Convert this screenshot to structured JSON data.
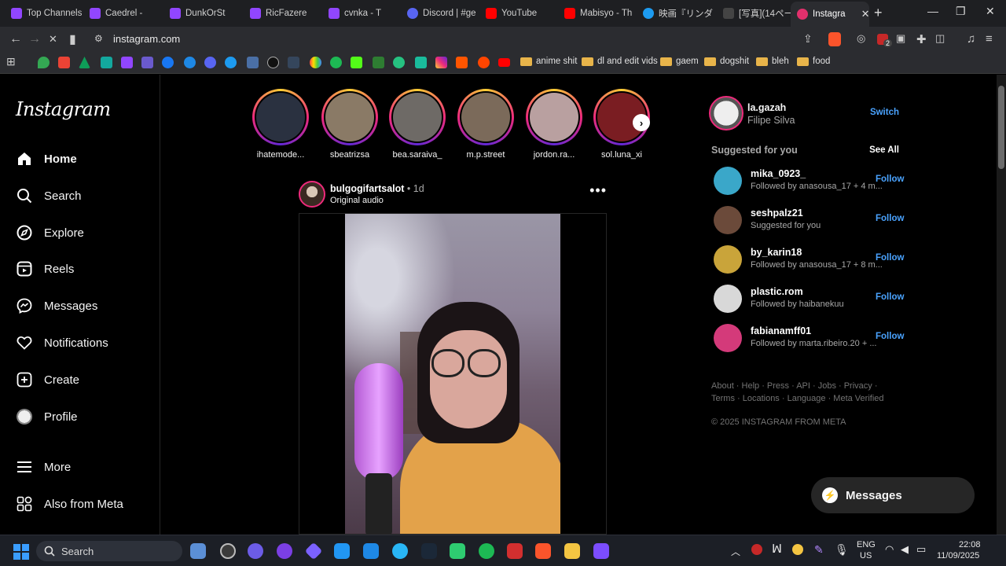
{
  "browser": {
    "tabs": [
      {
        "label": "Top Channels",
        "color": "#9146ff"
      },
      {
        "label": "Caedrel -",
        "color": "#9146ff"
      },
      {
        "label": "DunkOrSt",
        "color": "#9146ff"
      },
      {
        "label": "RicFazere",
        "color": "#9146ff"
      },
      {
        "label": "cvnka - T",
        "color": "#9146ff"
      },
      {
        "label": "Discord | #ge",
        "color": "#5865f2"
      },
      {
        "label": "YouTube",
        "color": "#ff0000"
      },
      {
        "label": "Mabisyo - Th",
        "color": "#ff0000"
      },
      {
        "label": "映画『リンダ リ",
        "color": "#1d9bf0"
      },
      {
        "label": "[写真](14ペー",
        "color": "#444444"
      },
      {
        "label": "Instagra",
        "color": "#e1306c"
      }
    ],
    "active_tab_close": "✕",
    "new_tab": "+",
    "url": "instagram.com",
    "bookmark_folders": [
      "anime shit",
      "dl and edit vids",
      "gaem",
      "dogshit",
      "bleh",
      "food"
    ],
    "extension_badge": "2"
  },
  "sidebar": {
    "logo": "Instagram",
    "items": [
      {
        "label": "Home",
        "icon": "home-icon"
      },
      {
        "label": "Search",
        "icon": "search-icon"
      },
      {
        "label": "Explore",
        "icon": "compass-icon"
      },
      {
        "label": "Reels",
        "icon": "reels-icon"
      },
      {
        "label": "Messages",
        "icon": "messenger-icon"
      },
      {
        "label": "Notifications",
        "icon": "heart-icon"
      },
      {
        "label": "Create",
        "icon": "plus-square-icon"
      },
      {
        "label": "Profile",
        "icon": "avatar"
      },
      {
        "label": "More",
        "icon": "menu-icon"
      },
      {
        "label": "Also from Meta",
        "icon": "meta-grid-icon"
      }
    ]
  },
  "stories": [
    {
      "name": "ihatemode...",
      "color": "#2a3140"
    },
    {
      "name": "sbeatrizsa",
      "color": "#8a7a66"
    },
    {
      "name": "bea.saraiva_",
      "color": "#6e6a66"
    },
    {
      "name": "m.p.street",
      "color": "#7b6a5a"
    },
    {
      "name": "jordon.ra...",
      "color": "#b9a0a0"
    },
    {
      "name": "sol.luna_xi",
      "color": "#7a1d22"
    }
  ],
  "post": {
    "username": "bulgogifartsalot",
    "separator": " • ",
    "time": "1d",
    "audio": "Original audio",
    "more": "•••"
  },
  "account": {
    "username": "la.gazah",
    "name": "Filipe Silva",
    "switch": "Switch"
  },
  "suggestions": {
    "title": "Suggested for you",
    "see_all": "See All",
    "follow_label": "Follow",
    "users": [
      {
        "username": "mika_0923_",
        "sub": "Followed by anasousa_17 + 4 m...",
        "color": "#3aa7c9"
      },
      {
        "username": "seshpalz21",
        "sub": "Suggested for you",
        "color": "#6b4a3a"
      },
      {
        "username": "by_karin18",
        "sub": "Followed by anasousa_17 + 8 m...",
        "color": "#c9a43a"
      },
      {
        "username": "plastic.rom",
        "sub": "Followed by haibanekuu",
        "color": "#d8d8d8"
      },
      {
        "username": "fabianamff01",
        "sub": "Followed by marta.ribeiro.20 + ...",
        "color": "#d43a7a"
      }
    ]
  },
  "footer": {
    "links": "About · Help · Press · API · Jobs · Privacy · Terms · Locations · Language · Meta Verified",
    "copyright": "© 2025 INSTAGRAM FROM META"
  },
  "messages_pill": "Messages",
  "taskbar": {
    "search": "Search",
    "lang_top": "ENG",
    "lang_bottom": "US",
    "time": "22:08",
    "date": "11/09/2025"
  }
}
